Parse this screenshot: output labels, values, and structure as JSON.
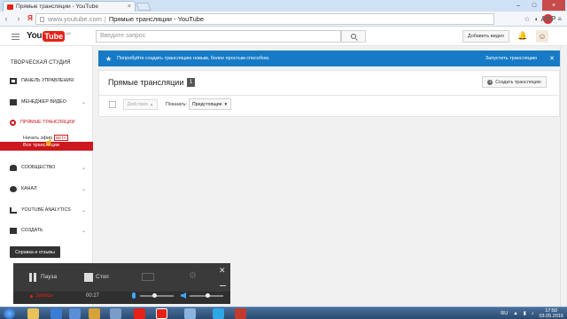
{
  "browser": {
    "tab_title": "Прямые трансляции - YouTube",
    "tab_close": "×",
    "url": "www.youtube.com",
    "page_title": "Прямые трансляции - YouTube",
    "ya_label": "Я"
  },
  "header": {
    "logo_you": "You",
    "logo_tube": "Tube",
    "logo_region": "UA",
    "search_placeholder": "Введите запрос",
    "upload_label": "Добавить видео"
  },
  "sidebar": {
    "title": "ТВОРЧЕСКАЯ СТУДИЯ",
    "items": [
      {
        "label": "ПАНЕЛЬ УПРАВЛЕНИЯ"
      },
      {
        "label": "МЕНЕДЖЕР ВИДЕО"
      },
      {
        "label": "ПРЯМЫЕ ТРАНСЛЯЦИИ"
      },
      {
        "label": "СООБЩЕСТВО"
      },
      {
        "label": "КАНАЛ"
      },
      {
        "label": "YOUTUBE ANALYTICS"
      },
      {
        "label": "СОЗДАТЬ"
      }
    ],
    "sub_start": "Начать эфир",
    "sub_beta": "BETA",
    "sub_all": "Все трансляции",
    "help": "Справка и отзывы"
  },
  "banner": {
    "message": "Попробуйте создать трансляцию новым, более простым способом.",
    "button": "Запустить трансляцию"
  },
  "main": {
    "title": "Прямые трансляции",
    "count": "1",
    "create_button": "Создать трансляцию",
    "actions": "Действия",
    "show_label": "Показать:",
    "show_value": "Предстоящие"
  },
  "recorder": {
    "pause": "Пауза",
    "stop": "Стоп",
    "record": "Запись",
    "time": "00:27"
  },
  "taskbar": {
    "lang": "RU",
    "time": "17:50",
    "date": "03.05.2016"
  },
  "colors": {
    "youtube_red": "#e62117",
    "banner_blue": "#167ac6",
    "active_red": "#cc181e"
  }
}
